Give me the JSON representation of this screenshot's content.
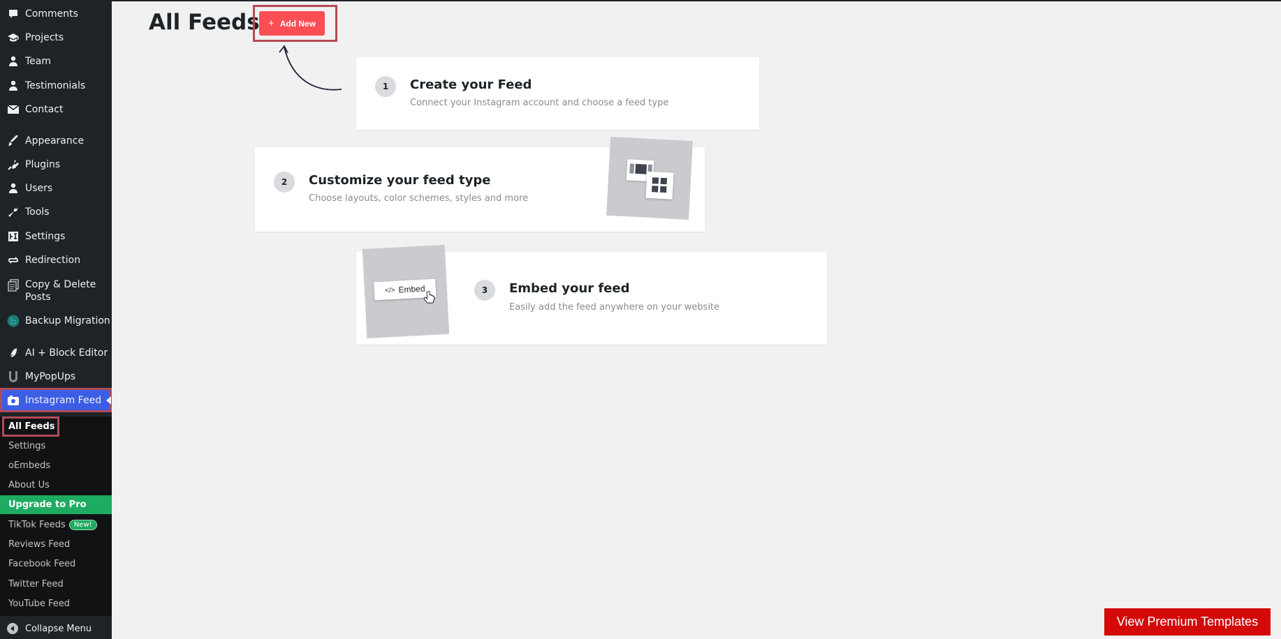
{
  "sidebar": {
    "items": [
      {
        "label": "Comments",
        "icon": "comment-icon"
      },
      {
        "label": "Projects",
        "icon": "graduation-cap-icon"
      },
      {
        "label": "Team",
        "icon": "user-icon"
      },
      {
        "label": "Testimonials",
        "icon": "user-icon"
      },
      {
        "label": "Contact",
        "icon": "envelope-icon"
      },
      {
        "label": "Appearance",
        "icon": "paintbrush-icon"
      },
      {
        "label": "Plugins",
        "icon": "plugin-icon"
      },
      {
        "label": "Users",
        "icon": "user-icon"
      },
      {
        "label": "Tools",
        "icon": "wrench-icon"
      },
      {
        "label": "Settings",
        "icon": "settings-icon"
      },
      {
        "label": "Redirection",
        "icon": "redirect-icon"
      },
      {
        "label": "Copy & Delete Posts",
        "icon": "copy-icon"
      },
      {
        "label": "Backup Migration",
        "icon": "backup-icon"
      },
      {
        "label": "AI + Block Editor",
        "icon": "pen-icon"
      },
      {
        "label": "MyPopUps",
        "icon": "mypopups-icon"
      },
      {
        "label": "Instagram Feed",
        "icon": "camera-icon"
      }
    ],
    "submenu": [
      {
        "label": "All Feeds"
      },
      {
        "label": "Settings"
      },
      {
        "label": "oEmbeds"
      },
      {
        "label": "About Us"
      },
      {
        "label": "Upgrade to Pro"
      },
      {
        "label": "TikTok Feeds",
        "badge": "New!"
      },
      {
        "label": "Reviews Feed"
      },
      {
        "label": "Facebook Feed"
      },
      {
        "label": "Twitter Feed"
      },
      {
        "label": "YouTube Feed"
      }
    ],
    "collapse_label": "Collapse Menu"
  },
  "main": {
    "title": "All Feeds",
    "add_new_label": "Add New",
    "steps": [
      {
        "num": "1",
        "title": "Create your Feed",
        "desc": "Connect your Instagram account and choose a feed type"
      },
      {
        "num": "2",
        "title": "Customize your feed type",
        "desc": "Choose layouts, color schemes, styles and more"
      },
      {
        "num": "3",
        "title": "Embed your feed",
        "desc": "Easily add the feed anywhere on your website"
      }
    ],
    "embed_label": "Embed",
    "premium_label": "View Premium Templates"
  },
  "colors": {
    "sidebar_bg": "#1d2327",
    "active_menu": "#3c5ee6",
    "add_new": "#fa4d54",
    "upgrade": "#1dab61",
    "premium": "#d40a0a",
    "highlight_outline": "#b34b56"
  }
}
